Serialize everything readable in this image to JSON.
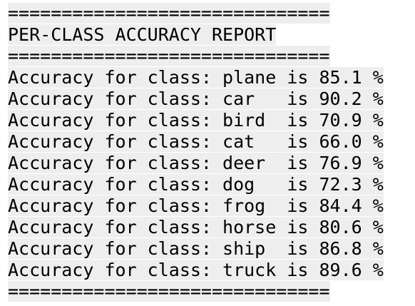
{
  "report": {
    "separator": "==============================",
    "title": "PER-CLASS ACCURACY REPORT",
    "lines": [
      "Accuracy for class: plane is 85.1 %",
      "Accuracy for class: car   is 90.2 %",
      "Accuracy for class: bird  is 70.9 %",
      "Accuracy for class: cat   is 66.0 %",
      "Accuracy for class: deer  is 76.9 %",
      "Accuracy for class: dog   is 72.3 %",
      "Accuracy for class: frog  is 84.4 %",
      "Accuracy for class: horse is 80.6 %",
      "Accuracy for class: ship  is 86.8 %",
      "Accuracy for class: truck is 89.6 %"
    ]
  },
  "colors": {
    "background": "#ffffff",
    "highlight": "#eeeeee",
    "text": "#000000"
  }
}
